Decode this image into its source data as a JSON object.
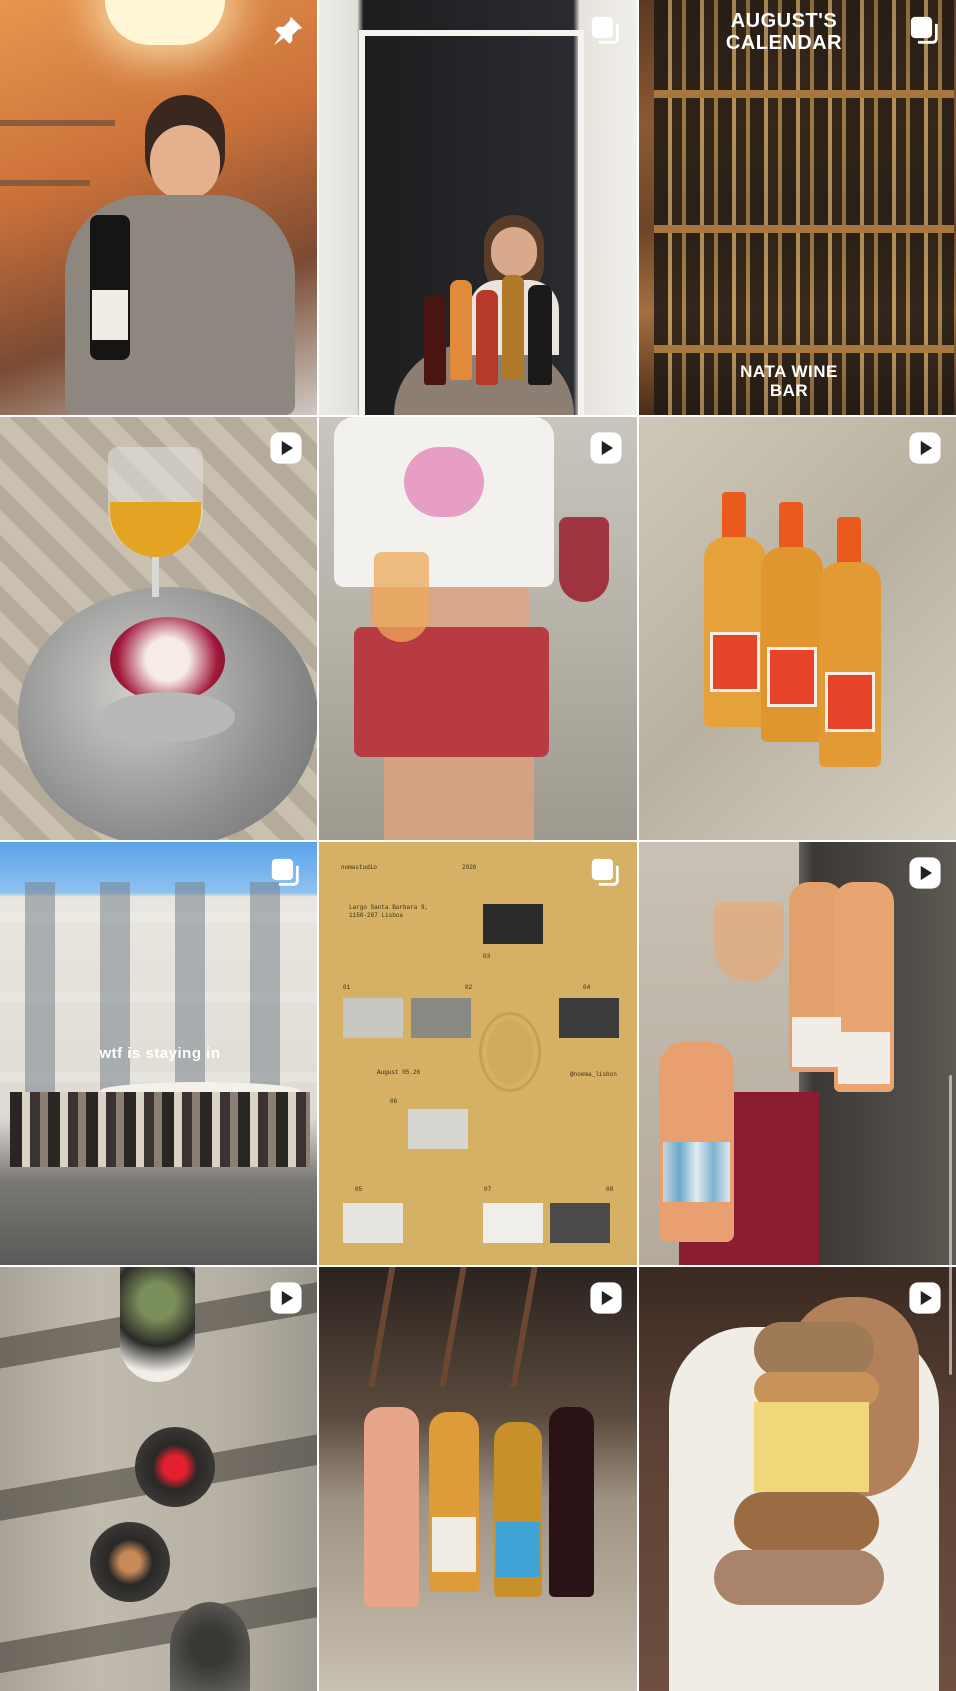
{
  "grid": {
    "posts": [
      {
        "id": "post-1",
        "type": "pinned",
        "icon": "pin-icon"
      },
      {
        "id": "post-2",
        "type": "carousel",
        "icon": "carousel-icon"
      },
      {
        "id": "post-3",
        "type": "carousel",
        "icon": "carousel-icon",
        "overlay_top": "AUGUST'S CALENDAR",
        "overlay_bottom": "NATA WINE BAR"
      },
      {
        "id": "post-4",
        "type": "reel",
        "icon": "reel-icon"
      },
      {
        "id": "post-5",
        "type": "reel",
        "icon": "reel-icon"
      },
      {
        "id": "post-6",
        "type": "reel",
        "icon": "reel-icon"
      },
      {
        "id": "post-7",
        "type": "carousel",
        "icon": "carousel-icon",
        "caption": "wtf is staying in"
      },
      {
        "id": "post-8",
        "type": "carousel",
        "icon": "carousel-icon",
        "poster": {
          "brand": "nomastudio",
          "year": "2026",
          "address_line1": "Largo Santa Barbara 9,",
          "address_line2": "1150-287 Lisboa",
          "date": "August 05.26",
          "handle": "@noema_lisbon",
          "numbers": [
            "01",
            "02",
            "03",
            "04",
            "05",
            "06",
            "07",
            "08"
          ]
        }
      },
      {
        "id": "post-9",
        "type": "reel",
        "icon": "reel-icon"
      },
      {
        "id": "post-10",
        "type": "reel",
        "icon": "reel-icon"
      },
      {
        "id": "post-11",
        "type": "reel",
        "icon": "reel-icon"
      },
      {
        "id": "post-12",
        "type": "reel",
        "icon": "reel-icon"
      }
    ]
  }
}
